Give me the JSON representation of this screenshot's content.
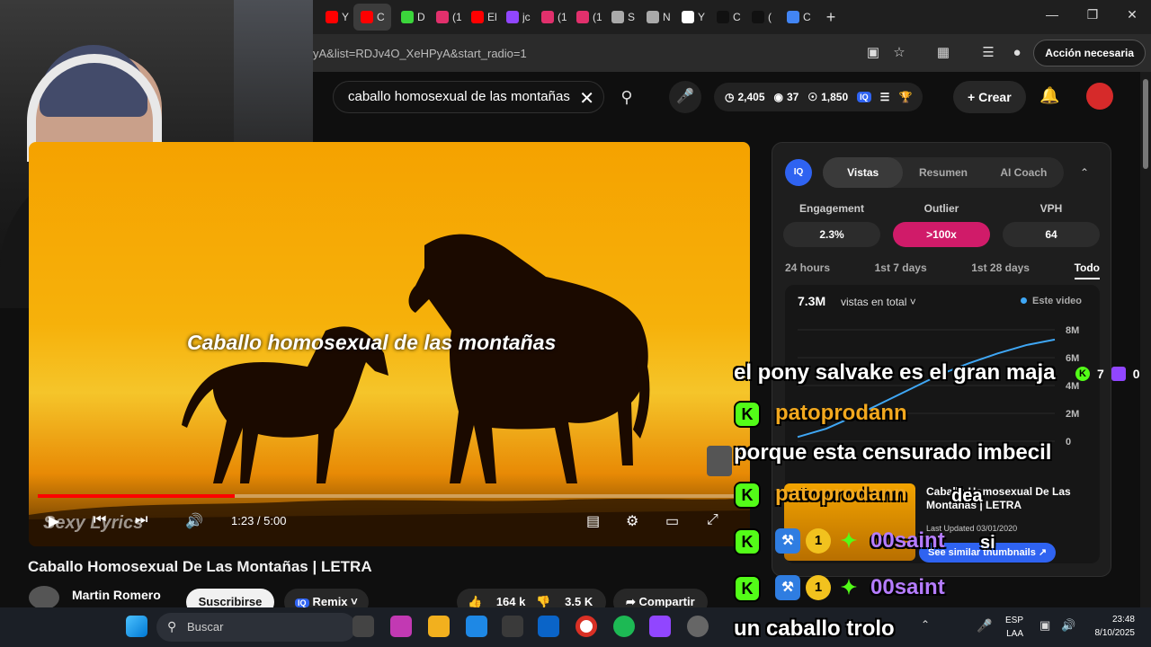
{
  "browser": {
    "tabs": [
      {
        "title": "Y",
        "color": "#ff0000"
      },
      {
        "title": "C",
        "color": "#ff0000",
        "active": true
      },
      {
        "title": "D",
        "color": "#3bd63b"
      },
      {
        "title": "(1",
        "color": "#e1306c"
      },
      {
        "title": "El",
        "color": "#ff0000"
      },
      {
        "title": "jc",
        "color": "#9146ff"
      },
      {
        "title": "(1",
        "color": "#e1306c"
      },
      {
        "title": "(1",
        "color": "#e1306c"
      },
      {
        "title": "S",
        "color": "#aaaaaa"
      },
      {
        "title": "N",
        "color": "#aaaaaa"
      },
      {
        "title": "Y",
        "color": "#ffffff"
      },
      {
        "title": "C",
        "color": "#111111"
      },
      {
        "title": "(",
        "color": "#111111"
      },
      {
        "title": "C",
        "color": "#4285f4"
      }
    ],
    "url": "yA&list=RDJv4O_XeHPyA&start_radio=1",
    "action_label": "Acción necesaria"
  },
  "youtube": {
    "search_query": "caballo homosexual de las montañas",
    "stats": {
      "views": "2,405",
      "likes": "37",
      "watch": "1,850"
    },
    "create_label": "Crear"
  },
  "video": {
    "lyric": "Caballo homosexual de las montañas",
    "watermark": "Sexy Lyrics",
    "time": "1:23 / 5:00",
    "progress": 0.28,
    "title": "Caballo Homosexual De Las Montañas | LETRA",
    "channel": "Martin Romero",
    "subscribe": "Suscribirse",
    "remix": "Remix",
    "likes": "164 k",
    "dislikes": "3.5 K",
    "share": "Compartir"
  },
  "vidiq": {
    "logo": "IQ",
    "tabs": [
      "Vistas",
      "Resumen",
      "AI Coach"
    ],
    "metrics": [
      {
        "label": "Engagement",
        "value": "2.3%"
      },
      {
        "label": "Outlier",
        "value": ">100x"
      },
      {
        "label": "VPH",
        "value": "64"
      }
    ],
    "ranges": [
      "24 hours",
      "1st 7 days",
      "1st 28 days",
      "Todo"
    ],
    "total": "7.3M",
    "views_selector": "vistas en total",
    "legend": "Este video",
    "y_ticks": [
      "8M",
      "6M",
      "4M",
      "2M",
      "0"
    ],
    "thumb_title": "Caballo Homosexual De Las Montañas | LETRA",
    "last_updated": "Last Updated 03/01/2020",
    "similar": "See similar thumbnails"
  },
  "chart_data": {
    "type": "line",
    "series": [
      {
        "name": "Este video",
        "values": [
          0.3,
          0.9,
          1.8,
          2.8,
          3.8,
          4.8,
          5.6,
          6.3,
          6.9,
          7.3
        ]
      }
    ],
    "y_ticks": [
      "8M",
      "6M",
      "4M",
      "2M",
      "0"
    ],
    "ylim": [
      0,
      8
    ]
  },
  "chat": {
    "messages": [
      {
        "text": "el pony salvake es el gran maja"
      },
      {
        "user": "patoprodann",
        "user_color": "#f2a81e"
      },
      {
        "text": "porque esta censurado imbecil"
      },
      {
        "user": "patoprodann",
        "user_color": "#f2a81e",
        "text": "dea"
      },
      {
        "user": "00saint",
        "user_color": "#b57cff",
        "text": "si"
      },
      {
        "user": "00saint",
        "user_color": "#b57cff"
      },
      {
        "text": "un caballo trolo"
      }
    ],
    "viewer_kick": "7",
    "viewer_twitch": "0"
  },
  "taskbar": {
    "search": "Buscar",
    "lang_top": "ESP",
    "lang_bottom": "LAA",
    "time": "23:48",
    "date": "8/10/2025"
  }
}
